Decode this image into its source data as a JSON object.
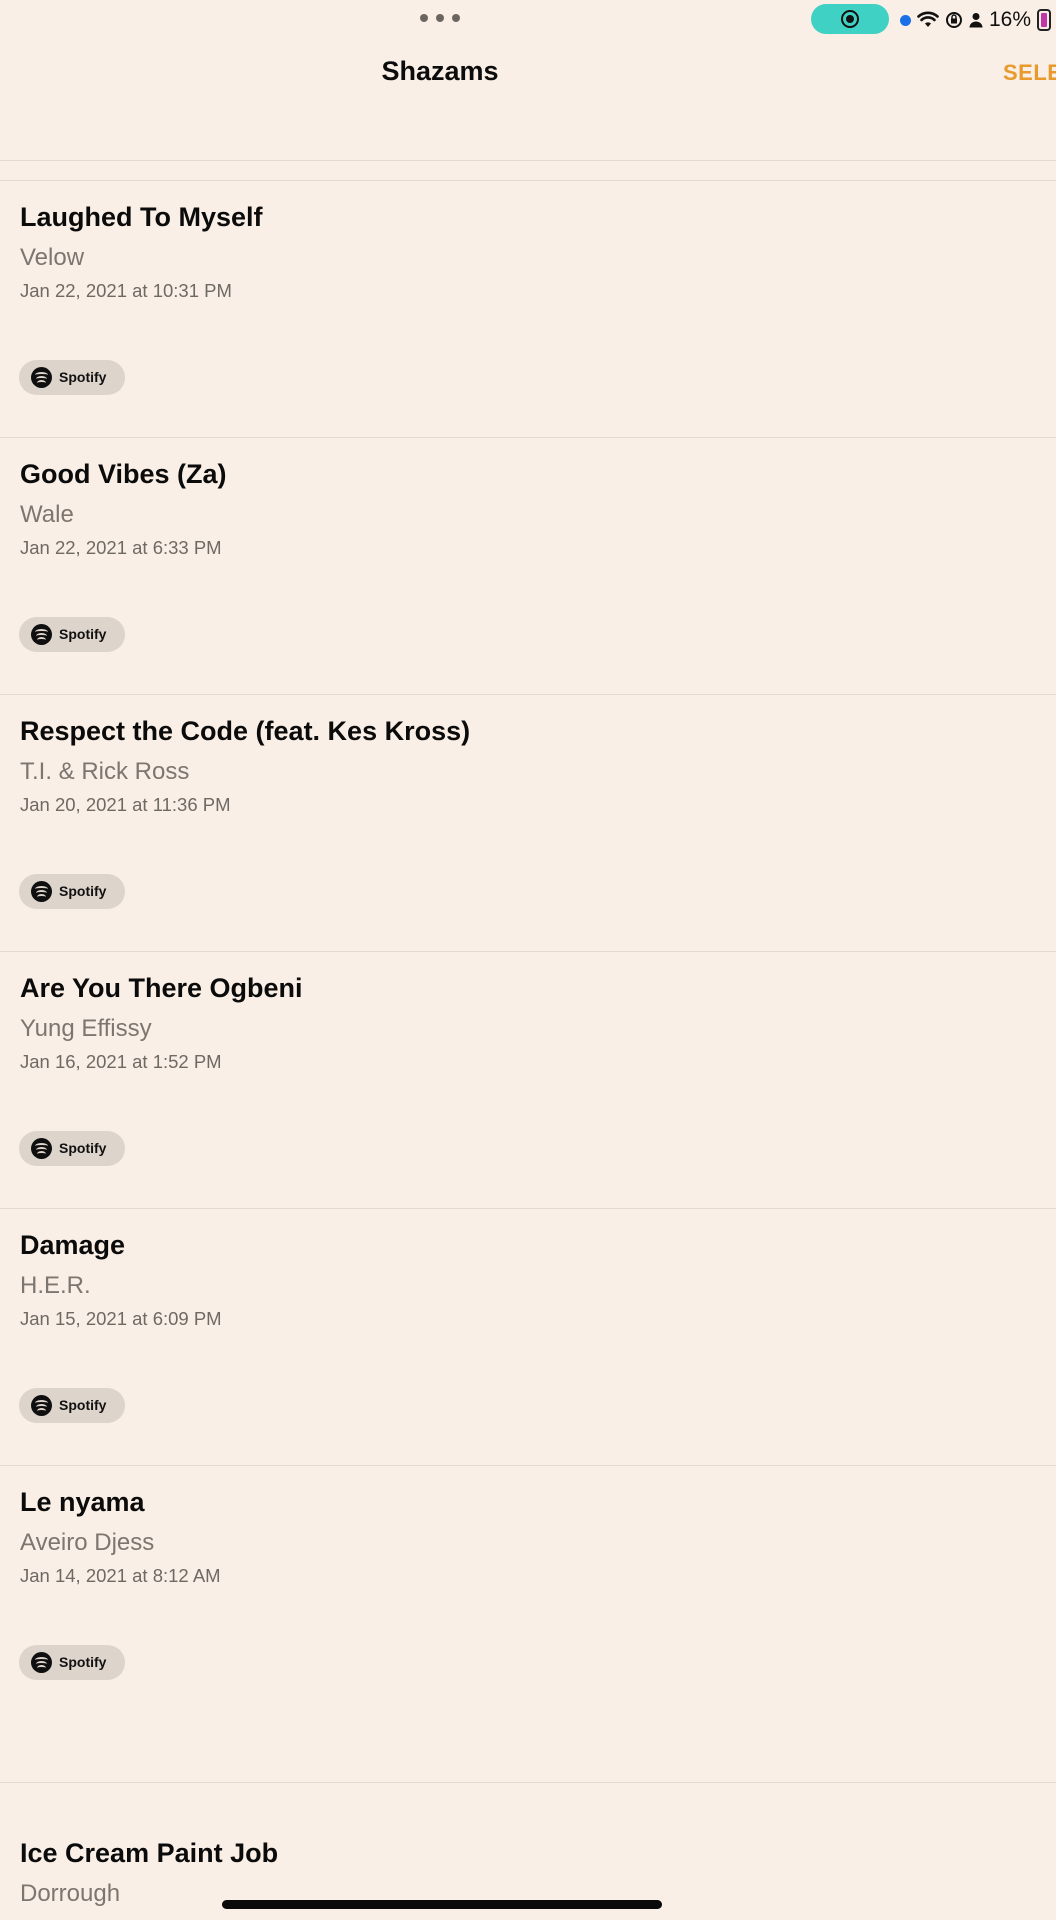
{
  "status_bar": {
    "battery_percent": "16%"
  },
  "header": {
    "title": "Shazams",
    "select_label": "SELE"
  },
  "items": [
    {
      "title": "Laughed To Myself",
      "artist": "Velow",
      "date": "Jan 22, 2021 at 10:31 PM",
      "service": "Spotify"
    },
    {
      "title": "Good Vibes (Za)",
      "artist": "Wale",
      "date": "Jan 22, 2021 at 6:33 PM",
      "service": "Spotify"
    },
    {
      "title": "Respect the Code (feat. Kes Kross)",
      "artist": "T.I. & Rick Ross",
      "date": "Jan 20, 2021 at 11:36 PM",
      "service": "Spotify"
    },
    {
      "title": "Are You There Ogbeni",
      "artist": "Yung Effissy",
      "date": "Jan 16, 2021 at 1:52 PM",
      "service": "Spotify"
    },
    {
      "title": "Damage",
      "artist": "H.E.R.",
      "date": "Jan 15, 2021 at 6:09 PM",
      "service": "Spotify"
    },
    {
      "title": "Le nyama",
      "artist": "Aveiro Djess",
      "date": "Jan 14, 2021 at 8:12 AM",
      "service": "Spotify"
    }
  ],
  "partial_item": {
    "title": "Ice Cream Paint Job",
    "artist": "Dorrough"
  }
}
